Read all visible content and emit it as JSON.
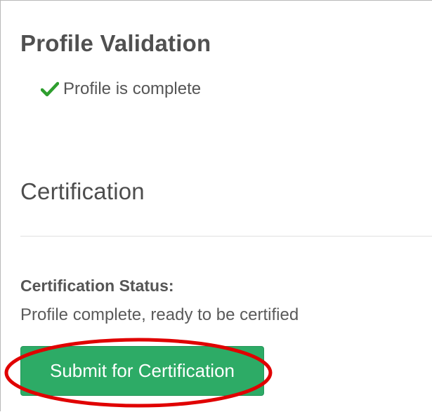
{
  "profile_validation": {
    "title": "Profile Validation",
    "check_icon": "checkmark-icon",
    "check_color": "#2e9e2e",
    "status_text": "Profile is complete"
  },
  "certification": {
    "title": "Certification",
    "status_label": "Certification Status:",
    "status_text": "Profile complete, ready to be certified",
    "submit_label": "Submit for Certification",
    "button_color": "#2dab66",
    "highlight_color": "#e00000"
  }
}
